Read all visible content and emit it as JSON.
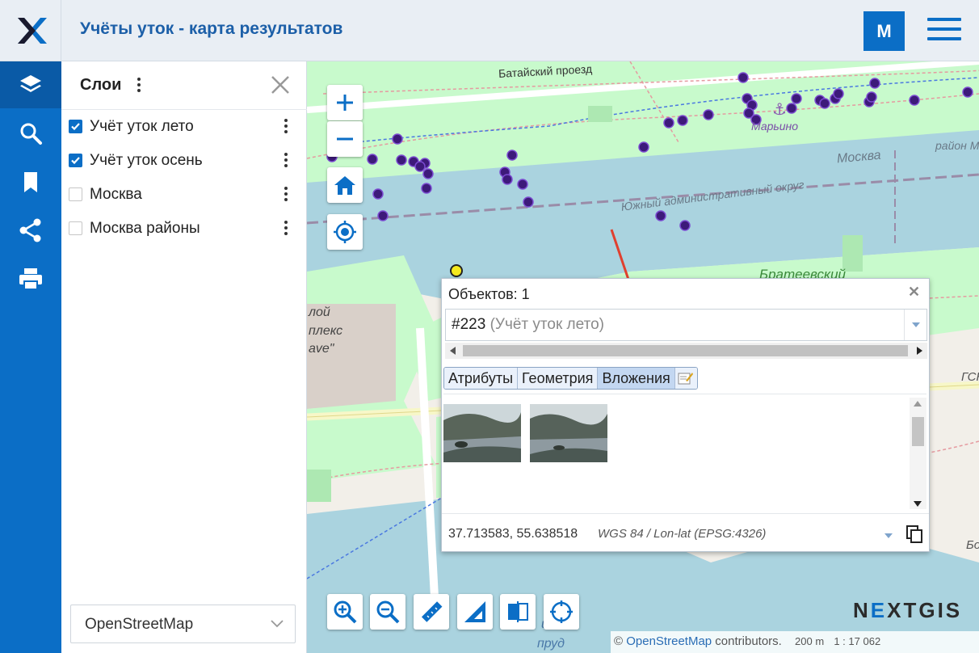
{
  "header": {
    "app_title": "Учёты уток - карта результатов",
    "user_initial": "M"
  },
  "rail": {
    "items": [
      "layers-icon",
      "search-icon",
      "bookmark-icon",
      "share-icon",
      "print-icon"
    ]
  },
  "layers_panel": {
    "title": "Слои",
    "layers": [
      {
        "label": "Учёт уток лето",
        "checked": true
      },
      {
        "label": "Учёт уток осень",
        "checked": true
      },
      {
        "label": "Москва",
        "checked": false
      },
      {
        "label": "Москва районы",
        "checked": false
      }
    ],
    "basemap": "OpenStreetMap"
  },
  "map": {
    "labels": {
      "street": "Батайский проезд",
      "district_marino": "Марьино",
      "river": "Москва",
      "okrug": "Южный административный округ",
      "raion": "район М",
      "brateevsky": "Братеевский",
      "complex1": "лой",
      "complex2": "плекс",
      "complex3": "ave\"",
      "bottom1": "ий",
      "bottom2": "пруд",
      "right_edge": "ГСК",
      "right_edge2": "Бо"
    },
    "attribution_prefix": "©",
    "attribution_link": "OpenStreetMap",
    "attribution_suffix": " contributors.",
    "scale_text": "200 m",
    "scale_ratio": "1 : 17 062",
    "brand_ne": "N",
    "brand_mid": "E",
    "brand_rest": "XTGIS"
  },
  "popup": {
    "title": "Объектов: 1",
    "feature_id": "#223",
    "feature_layer": "(Учёт уток лето)",
    "tabs": [
      "Атрибуты",
      "Геометрия",
      "Вложения"
    ],
    "active_tab": "Вложения",
    "coords": "37.713583, 55.638518",
    "crs": "WGS 84 / Lon-lat (EPSG:4326)"
  },
  "colors": {
    "accent": "#0b6ec6",
    "title": "#1c5fa8",
    "water": "#aad3df",
    "park": "#c8facc",
    "point": "#3d1a7a"
  }
}
